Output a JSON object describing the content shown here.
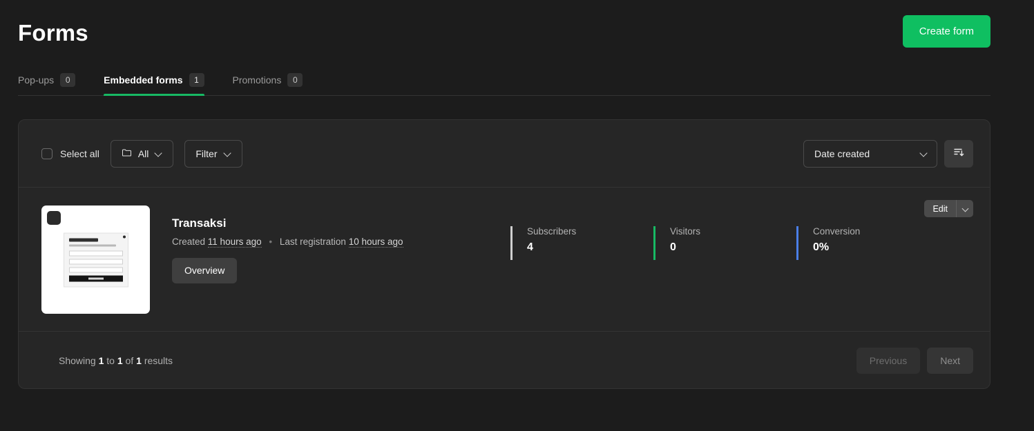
{
  "header": {
    "title": "Forms",
    "create_button": "Create form"
  },
  "tabs": [
    {
      "label": "Pop-ups",
      "badge": "0",
      "active": false
    },
    {
      "label": "Embedded forms",
      "badge": "1",
      "active": true
    },
    {
      "label": "Promotions",
      "badge": "0",
      "active": false
    }
  ],
  "toolbar": {
    "select_all_label": "Select all",
    "folder_filter": "All",
    "filter_label": "Filter",
    "sort_field": "Date created",
    "sort_icon": "sort-descending-icon",
    "folder_icon": "folder-icon",
    "chevron_icon": "chevron-down-icon"
  },
  "form": {
    "name": "Transaksi",
    "created_prefix": "Created",
    "created_value": "11 hours ago",
    "separator": "•",
    "last_registration_prefix": "Last registration",
    "last_registration_value": "10 hours ago",
    "overview_button": "Overview",
    "edit_button": "Edit",
    "thumbnail": {
      "preview_title": "Newsletter",
      "preview_subtitle": "Sign up to our news and special offers",
      "preview_fields": [
        "Email",
        "Name",
        "Phone"
      ],
      "preview_button": "Subscribe"
    },
    "stats": [
      {
        "label": "Subscribers",
        "value": "4",
        "accent": "#cfcfcf"
      },
      {
        "label": "Visitors",
        "value": "0",
        "accent": "#17b964"
      },
      {
        "label": "Conversion",
        "value": "0%",
        "accent": "#4a7fe8"
      }
    ]
  },
  "footer": {
    "showing_prefix": "Showing",
    "from": "1",
    "to_word": "to",
    "to": "1",
    "of_word": "of",
    "total": "1",
    "results_word": "results",
    "previous": "Previous",
    "next": "Next"
  },
  "colors": {
    "page_bg": "#1c1c1c",
    "panel_bg": "#262626",
    "accent_green": "#0fbf61",
    "accent_blue": "#4a7fe8"
  }
}
